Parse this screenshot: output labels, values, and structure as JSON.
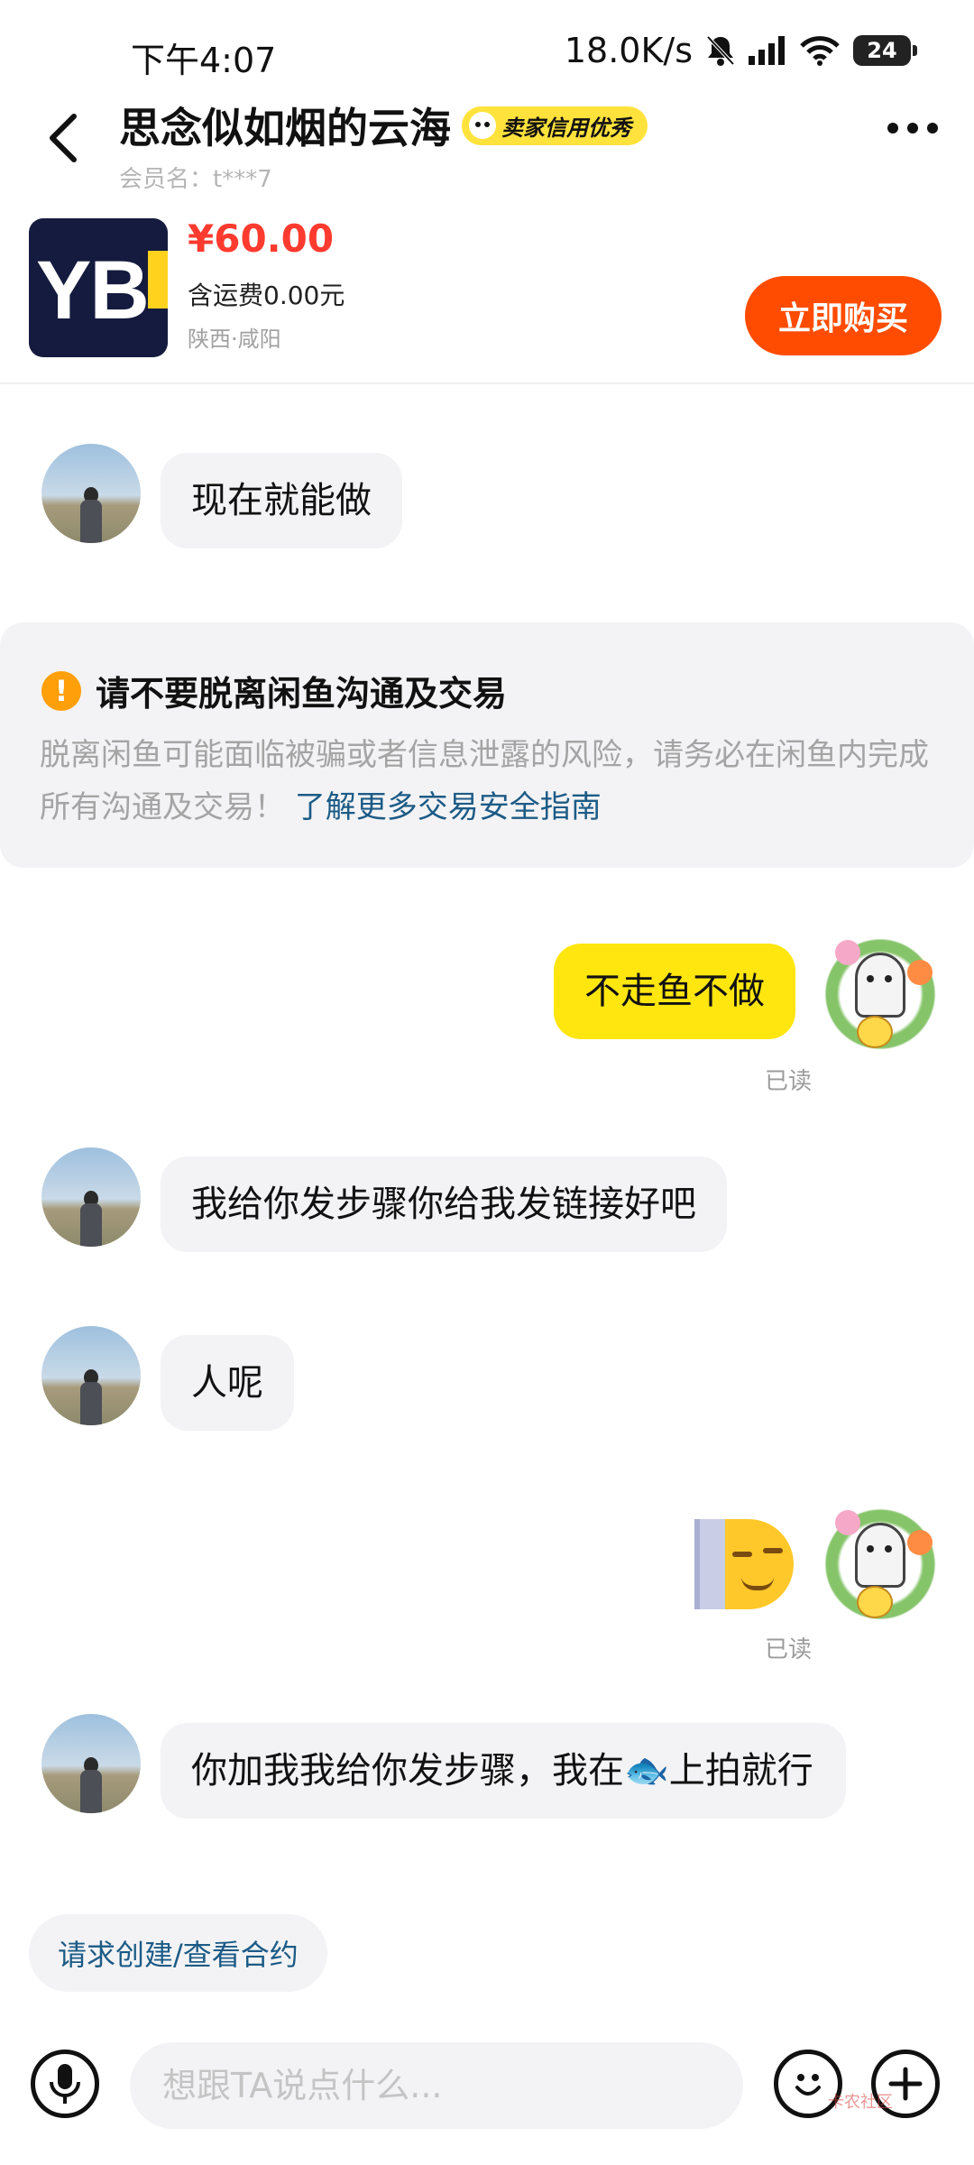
{
  "status_bar": {
    "time": "下午4:07",
    "network_speed": "18.0K/s",
    "battery": "24"
  },
  "header": {
    "title": "思念似如烟的云海",
    "badge": "卖家信用优秀",
    "member": "会员名：t***7"
  },
  "product": {
    "image_text": "YB",
    "price": "¥60.00",
    "shipping": "含运费0.00元",
    "location": "陕西·咸阳",
    "buy_label": "立即购买"
  },
  "messages": [
    {
      "from": "seller",
      "text": "现在就能做"
    },
    {
      "from": "me",
      "text": "不走鱼不做",
      "status": "已读"
    },
    {
      "from": "seller",
      "text": "我给你发步骤你给我发链接好吧"
    },
    {
      "from": "seller",
      "text": "人呢"
    },
    {
      "from": "me",
      "status": "已读"
    },
    {
      "from": "seller",
      "text": "你加我我给你发步骤，我在🐟上拍就行"
    }
  ],
  "notice": {
    "title": "请不要脱离闲鱼沟通及交易",
    "body": "脱离闲鱼可能面临被骗或者信息泄露的风险，请务必在闲鱼内完成所有沟通及交易！",
    "link": "了解更多交易安全指南"
  },
  "contract_button": "请求创建/查看合约",
  "input": {
    "placeholder": "想跟TA说点什么..."
  },
  "watermark": "卡农社区",
  "colors": {
    "accent_yellow": "#ffe60f",
    "buy_orange": "#ff4c00",
    "price_red": "#ff3b30",
    "link_blue": "#1c5b86"
  }
}
